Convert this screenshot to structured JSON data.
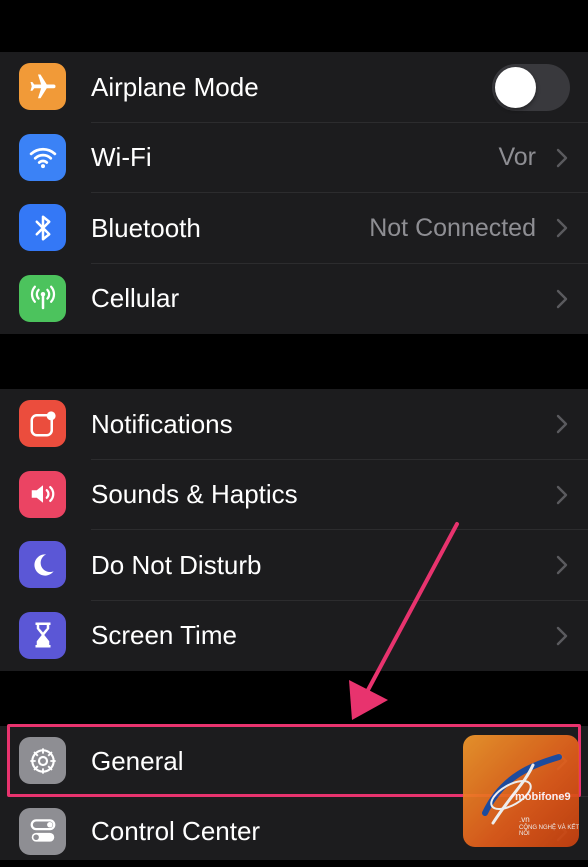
{
  "colors": {
    "background": "#000000",
    "cell": "#1c1c1e",
    "secondary_text": "#8e8e93",
    "highlight": "#e8336e"
  },
  "group1": [
    {
      "label": "Airplane Mode",
      "icon": "airplane-icon",
      "color": "#f19a38",
      "toggle": false
    },
    {
      "label": "Wi-Fi",
      "icon": "wifi-icon",
      "color": "#3b82f6",
      "value": "Vor"
    },
    {
      "label": "Bluetooth",
      "icon": "bluetooth-icon",
      "color": "#3478f6",
      "value": "Not Connected"
    },
    {
      "label": "Cellular",
      "icon": "cellular-icon",
      "color": "#4cc35d"
    }
  ],
  "group2": [
    {
      "label": "Notifications",
      "icon": "notifications-icon",
      "color": "#eb4d3d"
    },
    {
      "label": "Sounds & Haptics",
      "icon": "speaker-icon",
      "color": "#eb4463"
    },
    {
      "label": "Do Not Disturb",
      "icon": "moon-icon",
      "color": "#5b57d6"
    },
    {
      "label": "Screen Time",
      "icon": "hourglass-icon",
      "color": "#5b57d6"
    }
  ],
  "group3": [
    {
      "label": "General",
      "icon": "gear-icon",
      "color": "#8e8e93"
    },
    {
      "label": "Control Center",
      "icon": "switches-icon",
      "color": "#8e8e93"
    }
  ],
  "watermark": {
    "brand": "mobifone9",
    "domain": ".vn",
    "tagline": "CÔNG NGHỆ VÀ KẾT NỐI"
  }
}
